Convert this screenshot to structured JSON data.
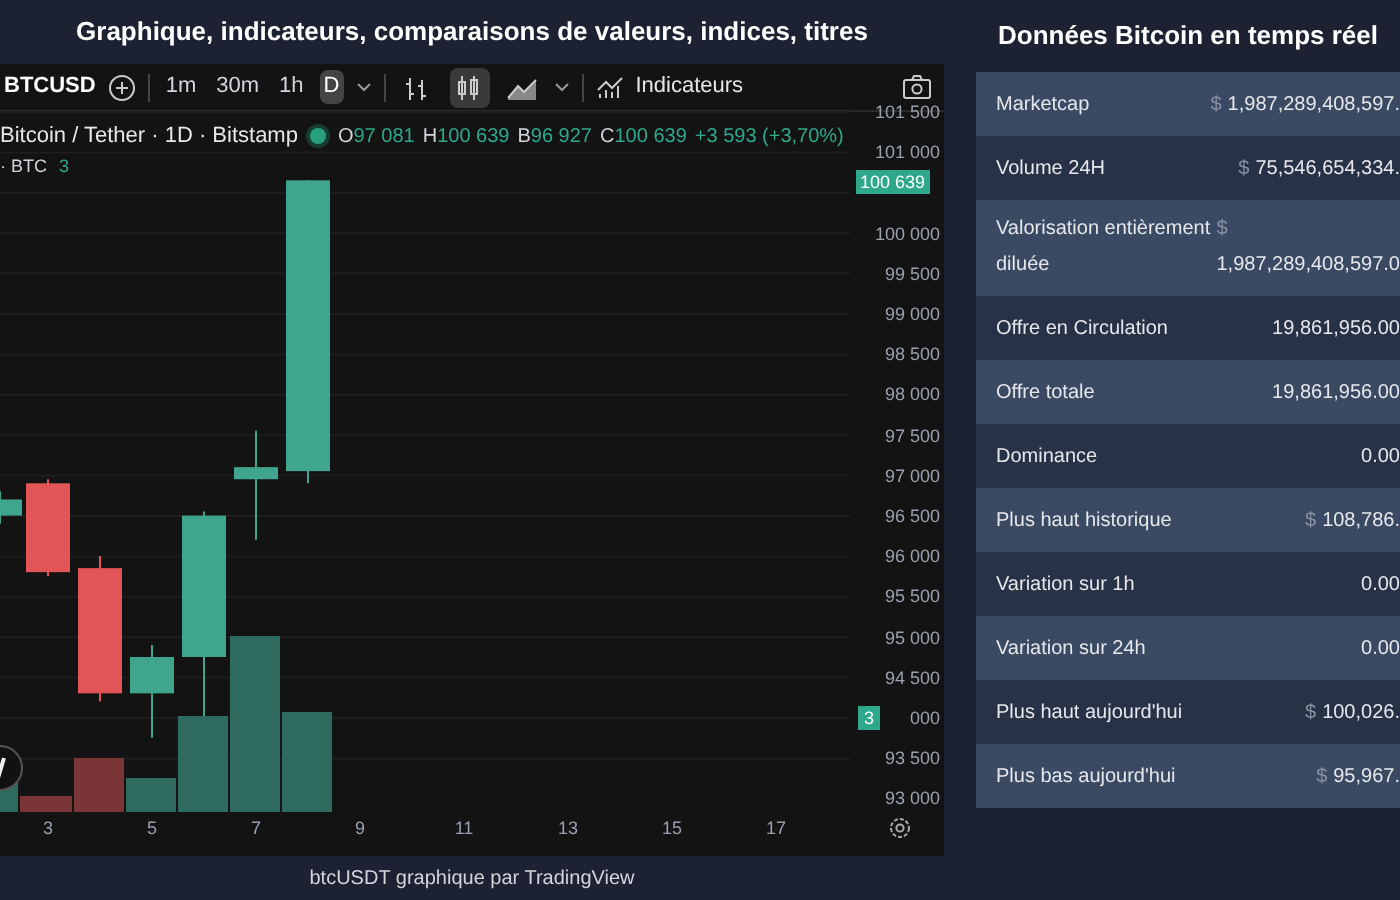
{
  "chart_panel": {
    "title": "Graphique, indicateurs, comparaisons de valeurs, indices, titres",
    "toolbar": {
      "symbol": "BTCUSD",
      "intervals": [
        {
          "label": "1m",
          "selected": false
        },
        {
          "label": "30m",
          "selected": false
        },
        {
          "label": "1h",
          "selected": false
        },
        {
          "label": "D",
          "selected": true
        }
      ],
      "chart_styles": [
        {
          "kind": "bars",
          "selected": false
        },
        {
          "kind": "candles",
          "selected": true
        },
        {
          "kind": "area",
          "selected": false
        }
      ],
      "indicators": "Indicateurs"
    },
    "legend": {
      "title": "Bitcoin / Tether · 1D · Bitstamp",
      "values": [
        {
          "label": "O",
          "value": "97 081"
        },
        {
          "label": "H",
          "value": "100 639"
        },
        {
          "label": "B",
          "value": "96 927"
        },
        {
          "label": "C",
          "value": "100 639"
        }
      ],
      "change": "+3 593 (+3,70%)",
      "volume_label": "· BTC",
      "volume_value": "3"
    },
    "price_axis": [
      "101 500",
      "101 000",
      "100 000",
      "99 500",
      "99 000",
      "98 500",
      "98 000",
      "97 500",
      "97 000",
      "96 500",
      "96 000",
      "95 500",
      "95 000",
      "94 500",
      "000",
      "93 500",
      "93 000"
    ],
    "price_tag": "100 639",
    "volume_tag": "3",
    "time_axis": [
      "3",
      "5",
      "7",
      "9",
      "11",
      "13",
      "15",
      "17"
    ],
    "footer": "btcUSDT graphique par TradingView"
  },
  "data_panel": {
    "title": "Données Bitcoin en temps réel",
    "rows": [
      {
        "label": "Marketcap",
        "currency": "$",
        "value": "1,987,289,408,597."
      },
      {
        "label": "Volume 24H",
        "currency": "$",
        "value": "75,546,654,334."
      },
      {
        "label": "Valorisation entièrement diluée",
        "currency": "$",
        "value": "1,987,289,408,597.0",
        "wrap": true
      },
      {
        "label": "Offre en Circulation",
        "value": "19,861,956.00"
      },
      {
        "label": "Offre totale",
        "value": "19,861,956.00"
      },
      {
        "label": "Dominance",
        "value": "0.00"
      },
      {
        "label": "Plus haut historique",
        "currency": "$",
        "value": "108,786."
      },
      {
        "label": "Variation sur 1h",
        "value": "0.00"
      },
      {
        "label": "Variation sur 24h",
        "value": "0.00"
      },
      {
        "label": "Plus haut aujourd'hui",
        "currency": "$",
        "value": "100,026."
      },
      {
        "label": "Plus bas aujourd'hui",
        "currency": "$",
        "value": "95,967."
      }
    ]
  }
}
